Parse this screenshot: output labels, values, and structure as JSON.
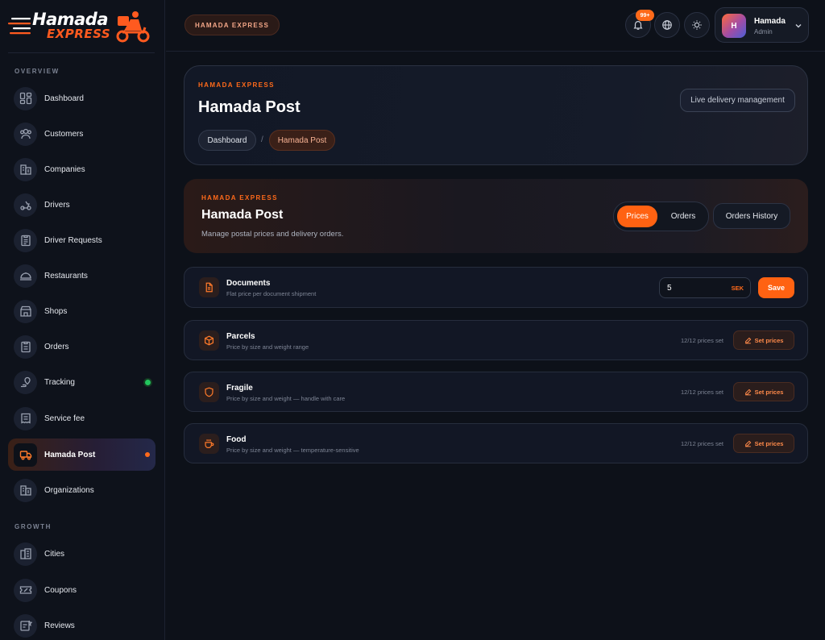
{
  "brand": {
    "line1": "Hamada",
    "line2": "EXPRESS"
  },
  "sidebar": {
    "sections": {
      "overview": "OVERVIEW",
      "growth": "GROWTH"
    },
    "items": [
      {
        "label": "Dashboard",
        "icon": "dashboard-icon"
      },
      {
        "label": "Customers",
        "icon": "users-icon"
      },
      {
        "label": "Companies",
        "icon": "buildings-icon"
      },
      {
        "label": "Drivers",
        "icon": "scooter-icon"
      },
      {
        "label": "Driver Requests",
        "icon": "clipboard-icon"
      },
      {
        "label": "Restaurants",
        "icon": "cloche-icon"
      },
      {
        "label": "Shops",
        "icon": "store-icon"
      },
      {
        "label": "Orders",
        "icon": "orders-icon"
      },
      {
        "label": "Tracking",
        "icon": "map-pin-icon",
        "status": "online"
      },
      {
        "label": "Service fee",
        "icon": "receipt-icon"
      },
      {
        "label": "Hamada Post",
        "icon": "truck-icon",
        "active": true
      },
      {
        "label": "Organizations",
        "icon": "buildings-icon"
      }
    ],
    "growth_items": [
      {
        "label": "Cities",
        "icon": "city-icon"
      },
      {
        "label": "Coupons",
        "icon": "coupon-icon"
      },
      {
        "label": "Reviews",
        "icon": "review-icon"
      }
    ]
  },
  "topbar": {
    "brand_pill": "HAMADA EXPRESS",
    "notification_count": "99+",
    "user": {
      "initial": "H",
      "name": "Hamada",
      "role": "Admin"
    }
  },
  "header": {
    "eyebrow": "HAMADA EXPRESS",
    "title": "Hamada Post",
    "breadcrumb": [
      "Dashboard",
      "Hamada Post"
    ],
    "separator": "/",
    "live_button": "Live delivery management"
  },
  "banner": {
    "eyebrow": "HAMADA EXPRESS",
    "title": "Hamada Post",
    "subtitle": "Manage postal prices and delivery orders.",
    "tabs": [
      "Prices",
      "Orders"
    ],
    "active_tab": "Prices",
    "history_button": "Orders History"
  },
  "price_rows": [
    {
      "title": "Documents",
      "subtitle": "Flat price per document shipment",
      "icon": "document-icon",
      "value": "5",
      "currency": "SEK",
      "action": "Save"
    },
    {
      "title": "Parcels",
      "subtitle": "Price by size and weight range",
      "icon": "box-icon",
      "count": "12/12 prices set",
      "action": "Set prices"
    },
    {
      "title": "Fragile",
      "subtitle": "Price by size and weight — handle with care",
      "icon": "shield-icon",
      "count": "12/12 prices set",
      "action": "Set prices"
    },
    {
      "title": "Food",
      "subtitle": "Price by size and weight — temperature-sensitive",
      "icon": "cup-icon",
      "count": "12/12 prices set",
      "action": "Set prices"
    }
  ],
  "colors": {
    "accent": "#ff6212",
    "background": "#0d1119",
    "online": "#22c55e"
  }
}
